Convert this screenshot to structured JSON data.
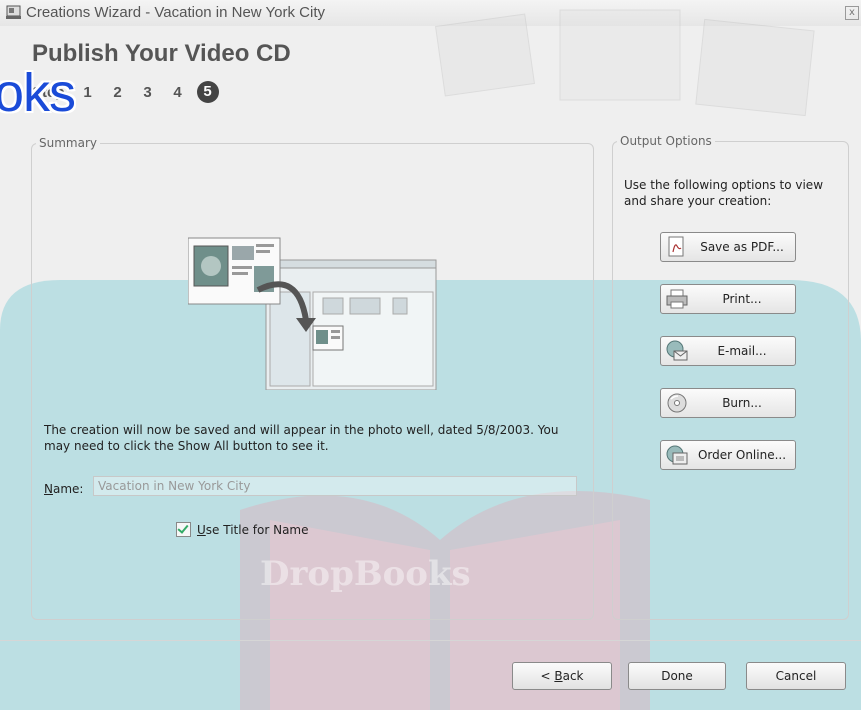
{
  "window": {
    "title": "Creations Wizard - Vacation in New York City",
    "close_glyph": "x"
  },
  "header": {
    "title": "Publish Your Video CD",
    "step_label": "Step",
    "steps": [
      "1",
      "2",
      "3",
      "4",
      "5"
    ],
    "active_step": "5"
  },
  "watermark": {
    "overlay_text": "oks",
    "book_text": "DropBooks"
  },
  "summary": {
    "legend": "Summary",
    "text": "The creation will now be saved and will appear in the photo well, dated 5/8/2003. You may need to click the Show All button to see it.",
    "name_label_first": "N",
    "name_label_rest": "ame:",
    "name_value": "Vacation in New York City",
    "checkbox_checked": true,
    "checkbox_label_first": "U",
    "checkbox_label_rest": "se Title for Name"
  },
  "output": {
    "legend": "Output Options",
    "description": "Use the following options to view and share your creation:",
    "buttons": [
      {
        "label": "Save as PDF...",
        "icon": "pdf-icon"
      },
      {
        "label": "Print...",
        "icon": "printer-icon"
      },
      {
        "label": "E-mail...",
        "icon": "email-icon"
      },
      {
        "label": "Burn...",
        "icon": "disc-icon"
      },
      {
        "label": "Order Online...",
        "icon": "online-order-icon"
      }
    ]
  },
  "footer": {
    "back_prefix": "< ",
    "back_accel": "B",
    "back_rest": "ack",
    "done": "Done",
    "cancel": "Cancel"
  },
  "colors": {
    "watermark_blue": "#1a4bd8",
    "watermark_cyan": "#5fc2cf",
    "watermark_pink": "#e8a0b0"
  }
}
